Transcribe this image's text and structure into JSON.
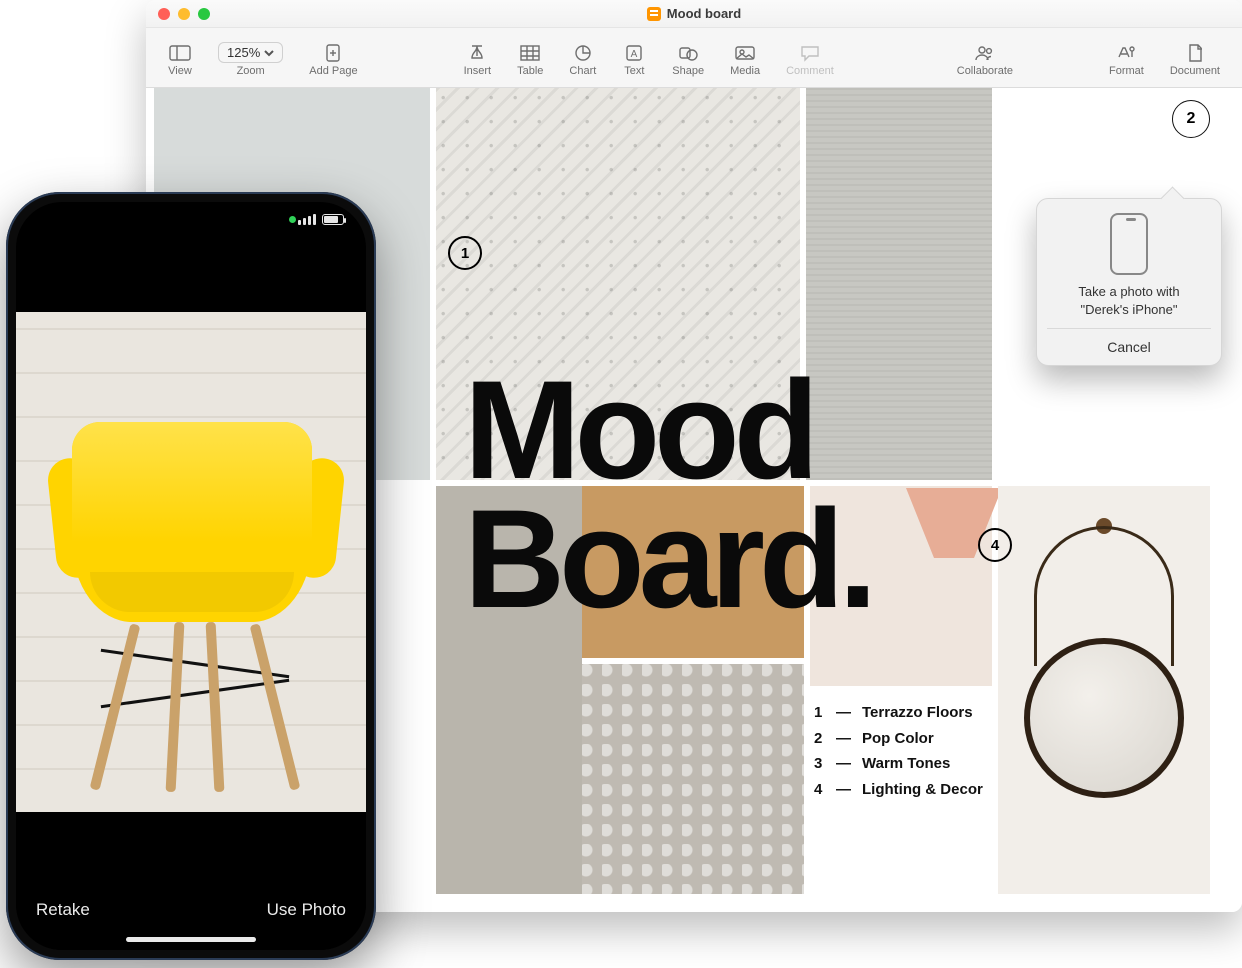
{
  "window": {
    "title": "Mood board"
  },
  "toolbar": {
    "view": "View",
    "zoom_label": "Zoom",
    "zoom_value": "125%",
    "add_page": "Add Page",
    "insert": "Insert",
    "table": "Table",
    "chart": "Chart",
    "text": "Text",
    "shape": "Shape",
    "media": "Media",
    "comment": "Comment",
    "collaborate": "Collaborate",
    "format": "Format",
    "document": "Document"
  },
  "document": {
    "page_badge": "2",
    "heading_line1": "Mood",
    "heading_line2": "Board.",
    "callouts": {
      "c1": "1",
      "c4": "4"
    },
    "legend": [
      {
        "n": "1",
        "label": "Terrazzo Floors"
      },
      {
        "n": "2",
        "label": "Pop Color"
      },
      {
        "n": "3",
        "label": "Warm Tones"
      },
      {
        "n": "4",
        "label": "Lighting & Decor"
      }
    ]
  },
  "popover": {
    "text_line1": "Take a photo with",
    "text_line2": "\"Derek's iPhone\"",
    "cancel": "Cancel"
  },
  "iphone": {
    "retake": "Retake",
    "use_photo": "Use Photo"
  }
}
